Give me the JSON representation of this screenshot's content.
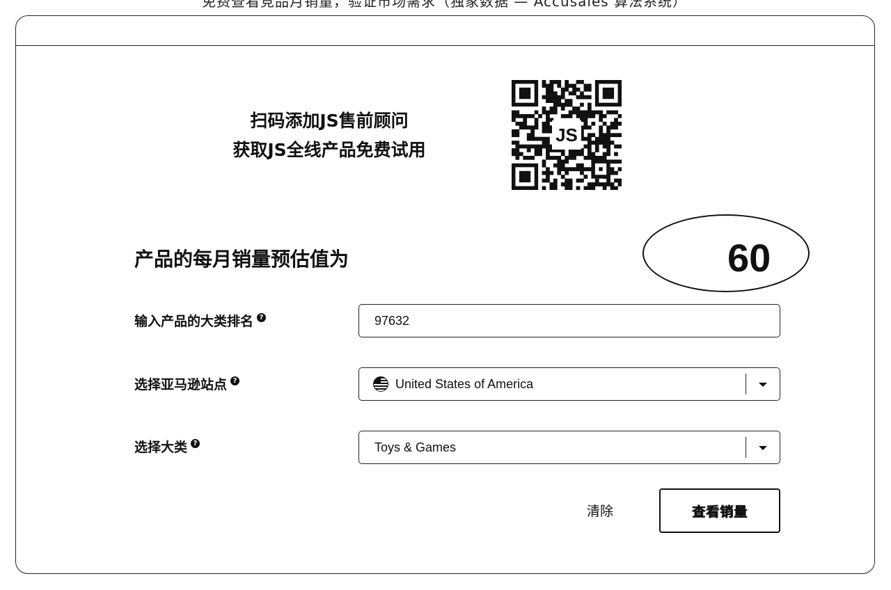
{
  "top_banner": {
    "text": "免费查看竞品月销量，验证市场需求（独家数据 — Accusales 算法系统）"
  },
  "promo": {
    "line1": "扫码添加JS售前顾问",
    "line2": "获取JS全线产品免费试用",
    "qr_icon": "qr-code-icon",
    "qr_logo": "JS"
  },
  "result": {
    "label": "产品的每月销量预估值为",
    "value": "60"
  },
  "form": {
    "rank": {
      "label": "输入产品的大类排名",
      "value": "97632",
      "help_icon": "help-icon"
    },
    "site": {
      "label": "选择亚马逊站点",
      "value": "United States of America",
      "flag_icon": "us-flag-icon",
      "help_icon": "help-icon"
    },
    "category": {
      "label": "选择大类",
      "value": "Toys & Games",
      "help_icon": "help-icon"
    }
  },
  "actions": {
    "clear_label": "清除",
    "query_label": "查看销量"
  },
  "colors": {
    "ink": "#111111",
    "background": "#ffffff"
  }
}
